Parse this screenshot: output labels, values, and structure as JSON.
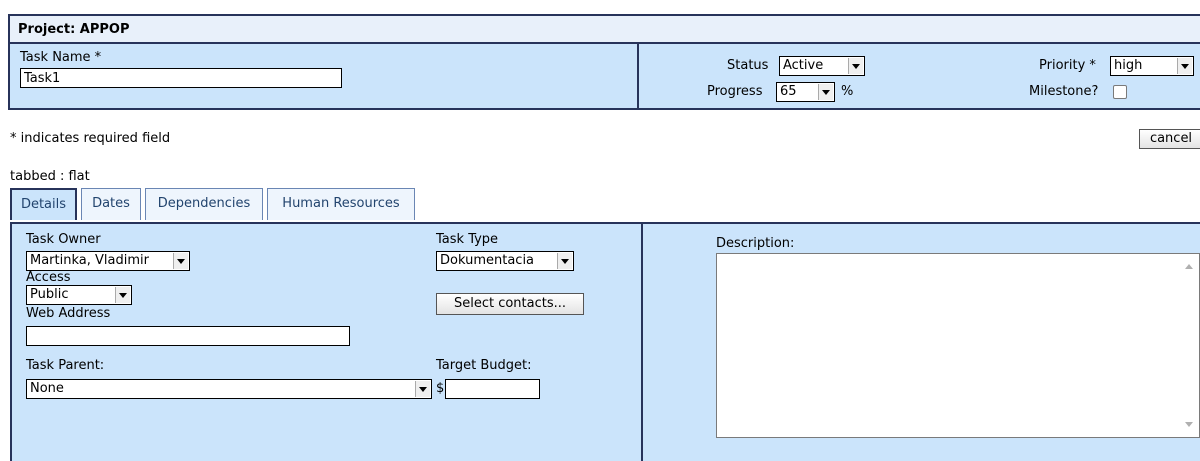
{
  "project": {
    "title": "Project: APPOP"
  },
  "task": {
    "name_label": "Task Name *",
    "name_value": "Task1",
    "status_label": "Status",
    "status_value": "Active",
    "progress_label": "Progress",
    "progress_value": "65",
    "progress_unit": "%",
    "priority_label": "Priority *",
    "priority_value": "high",
    "milestone_label": "Milestone?",
    "milestone_checked": false
  },
  "notes": {
    "required_text": "* indicates required field",
    "tabbed_text": "tabbed : flat"
  },
  "buttons": {
    "cancel": "cancel",
    "select_contacts": "Select contacts..."
  },
  "tabs": [
    {
      "label": "Details",
      "active": true
    },
    {
      "label": "Dates",
      "active": false
    },
    {
      "label": "Dependencies",
      "active": false
    },
    {
      "label": "Human Resources",
      "active": false
    }
  ],
  "details": {
    "owner_label": "Task Owner",
    "owner_value": "Martinka, Vladimir",
    "access_label": "Access",
    "access_value": "Public",
    "web_label": "Web Address",
    "web_value": "",
    "parent_label": "Task Parent:",
    "parent_value": "None",
    "type_label": "Task Type",
    "type_value": "Dokumentacia",
    "budget_label": "Target Budget:",
    "budget_currency": "$",
    "budget_value": "",
    "description_label": "Description:",
    "description_value": ""
  },
  "colors": {
    "panel_bg": "#cbe4fb",
    "border": "#27335a",
    "tab_text": "#22446e"
  }
}
